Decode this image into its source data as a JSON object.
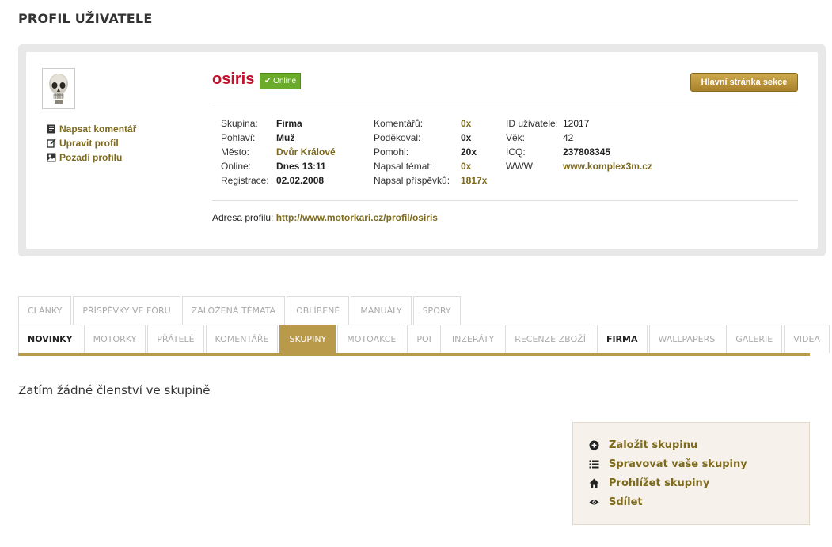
{
  "page": {
    "title": "PROFIL UŽIVATELE"
  },
  "profile": {
    "username": "osiris",
    "online_badge": "✔ Online",
    "main_section_button": "Hlavní stránka sekce",
    "side_links": [
      {
        "label": "Napsat komentář",
        "icon": "comment-icon"
      },
      {
        "label": "Upravit profil",
        "icon": "edit-icon"
      },
      {
        "label": "Pozadí profilu",
        "icon": "image-icon"
      }
    ],
    "stats_col1": [
      {
        "key": "Skupina:",
        "value": "Firma"
      },
      {
        "key": "Pohlaví:",
        "value": "Muž"
      },
      {
        "key": "Město:",
        "value": "Dvůr Králové"
      },
      {
        "key": "Online:",
        "value": "Dnes 13:11"
      },
      {
        "key": "Registrace:",
        "value": "02.02.2008"
      }
    ],
    "stats_col2": [
      {
        "key": "Komentářů:",
        "value": "0x"
      },
      {
        "key": "Poděkoval:",
        "value": "0x"
      },
      {
        "key": "Pomohl:",
        "value": "20x"
      },
      {
        "key": "Napsal témat:",
        "value": "0x"
      },
      {
        "key": "Napsal příspěvků:",
        "value": "1817x"
      }
    ],
    "stats_col3": [
      {
        "key": "ID uživatele:",
        "value": "12017"
      },
      {
        "key": "Věk:",
        "value": "42"
      },
      {
        "key": "ICQ:",
        "value": "237808345"
      },
      {
        "key": "WWW:",
        "value": "www.komplex3m.cz"
      }
    ],
    "address_label": "Adresa profilu:",
    "address_url": "http://www.motorkari.cz/profil/osiris"
  },
  "tabs": {
    "row1": [
      "CLÁNKY",
      "PŘÍSPĚVKY VE FÓRU",
      "ZALOŽENÁ TÉMATA",
      "OBLÍBENÉ",
      "MANUÁLY",
      "SPORY"
    ],
    "row2": [
      "NOVINKY",
      "MOTORKY",
      "PŘÁTELÉ",
      "KOMENTÁŘE",
      "SKUPINY",
      "MOTOAKCE",
      "POI",
      "INZERÁTY",
      "RECENZE ZBOŽÍ",
      "FIRMA",
      "WALLPAPERS",
      "GALERIE",
      "VIDEA"
    ],
    "active": "SKUPINY"
  },
  "content": {
    "empty_message": "Zatím žádné členství ve skupině",
    "group_actions": [
      {
        "label": "Založit skupinu",
        "icon": "plus-circle-icon"
      },
      {
        "label": "Spravovat vaše skupiny",
        "icon": "list-icon"
      },
      {
        "label": "Prohlížet skupiny",
        "icon": "home-icon"
      },
      {
        "label": "Sdílet",
        "icon": "eye-icon"
      }
    ]
  },
  "colors": {
    "accent_gold": "#b99a4a",
    "link_gold": "#7d6a1e",
    "username_red": "#c0102b",
    "online_green": "#6aab2a"
  }
}
